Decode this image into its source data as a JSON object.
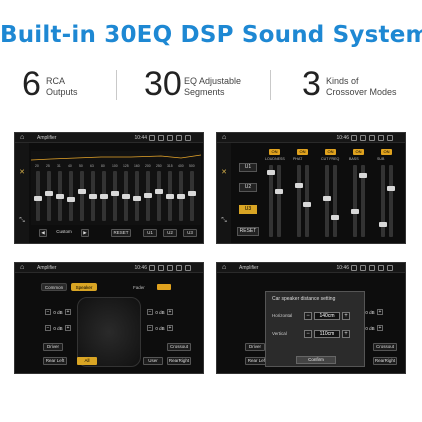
{
  "title": "Built-in 30EQ DSP Sound System",
  "stats": [
    {
      "number": "6",
      "label_line1": "RCA",
      "label_line2": "Outputs"
    },
    {
      "number": "30",
      "label_line1": "EQ Adjustable",
      "label_line2": "Segments"
    },
    {
      "number": "3",
      "label_line1": "Kinds of",
      "label_line2": "Crossover Modes"
    }
  ],
  "status": {
    "app": "Amplifier",
    "time": "10:44",
    "time2": "10:46"
  },
  "eq_panel": {
    "freqs": [
      "20",
      "25",
      "31",
      "40",
      "50",
      "63",
      "80",
      "100",
      "125",
      "160",
      "200",
      "250",
      "315",
      "400",
      "500"
    ],
    "levels": [
      0.45,
      0.55,
      0.5,
      0.42,
      0.6,
      0.5,
      0.48,
      0.55,
      0.5,
      0.45,
      0.52,
      0.6,
      0.5,
      0.48,
      0.55
    ],
    "preset": "Custom",
    "reset": "RESET",
    "users": [
      "U1",
      "U2",
      "U3"
    ]
  },
  "crossover_panel": {
    "users": [
      "U1",
      "U2",
      "U3"
    ],
    "selected_user": "U3",
    "reset": "RESET",
    "on_label": "ON",
    "columns": [
      "LOUDNESS",
      "PHAT",
      "CUT FREQ",
      "BASS",
      "SUB"
    ]
  },
  "fader_panel": {
    "tabs": [
      "Common",
      "Speaker"
    ],
    "fader": "Fader",
    "db_values": [
      "0 dB",
      "0 dB",
      "0 dB",
      "0 dB"
    ],
    "driver": "Driver",
    "crossout": "Crossout",
    "left_bottom": "Rear Left",
    "all": "All",
    "user": "User",
    "right_bottom": "RearRight"
  },
  "distance_panel": {
    "dialog_title": "Car speaker distance setting",
    "horizontal_label": "Horizontal",
    "horizontal_value": "140cm",
    "vertical_label": "Vertical",
    "vertical_value": "110cm",
    "confirm": "Confirm",
    "driver": "Driver",
    "crossout": "Crossout",
    "left_bottom": "Rear Left",
    "right_bottom": "RearRight",
    "db_values": [
      "0 dB",
      "0 dB"
    ]
  },
  "colors": {
    "accent": "#1e88d3",
    "ui_gold": "#d9a524",
    "screen_bg": "#0d0d0d"
  }
}
